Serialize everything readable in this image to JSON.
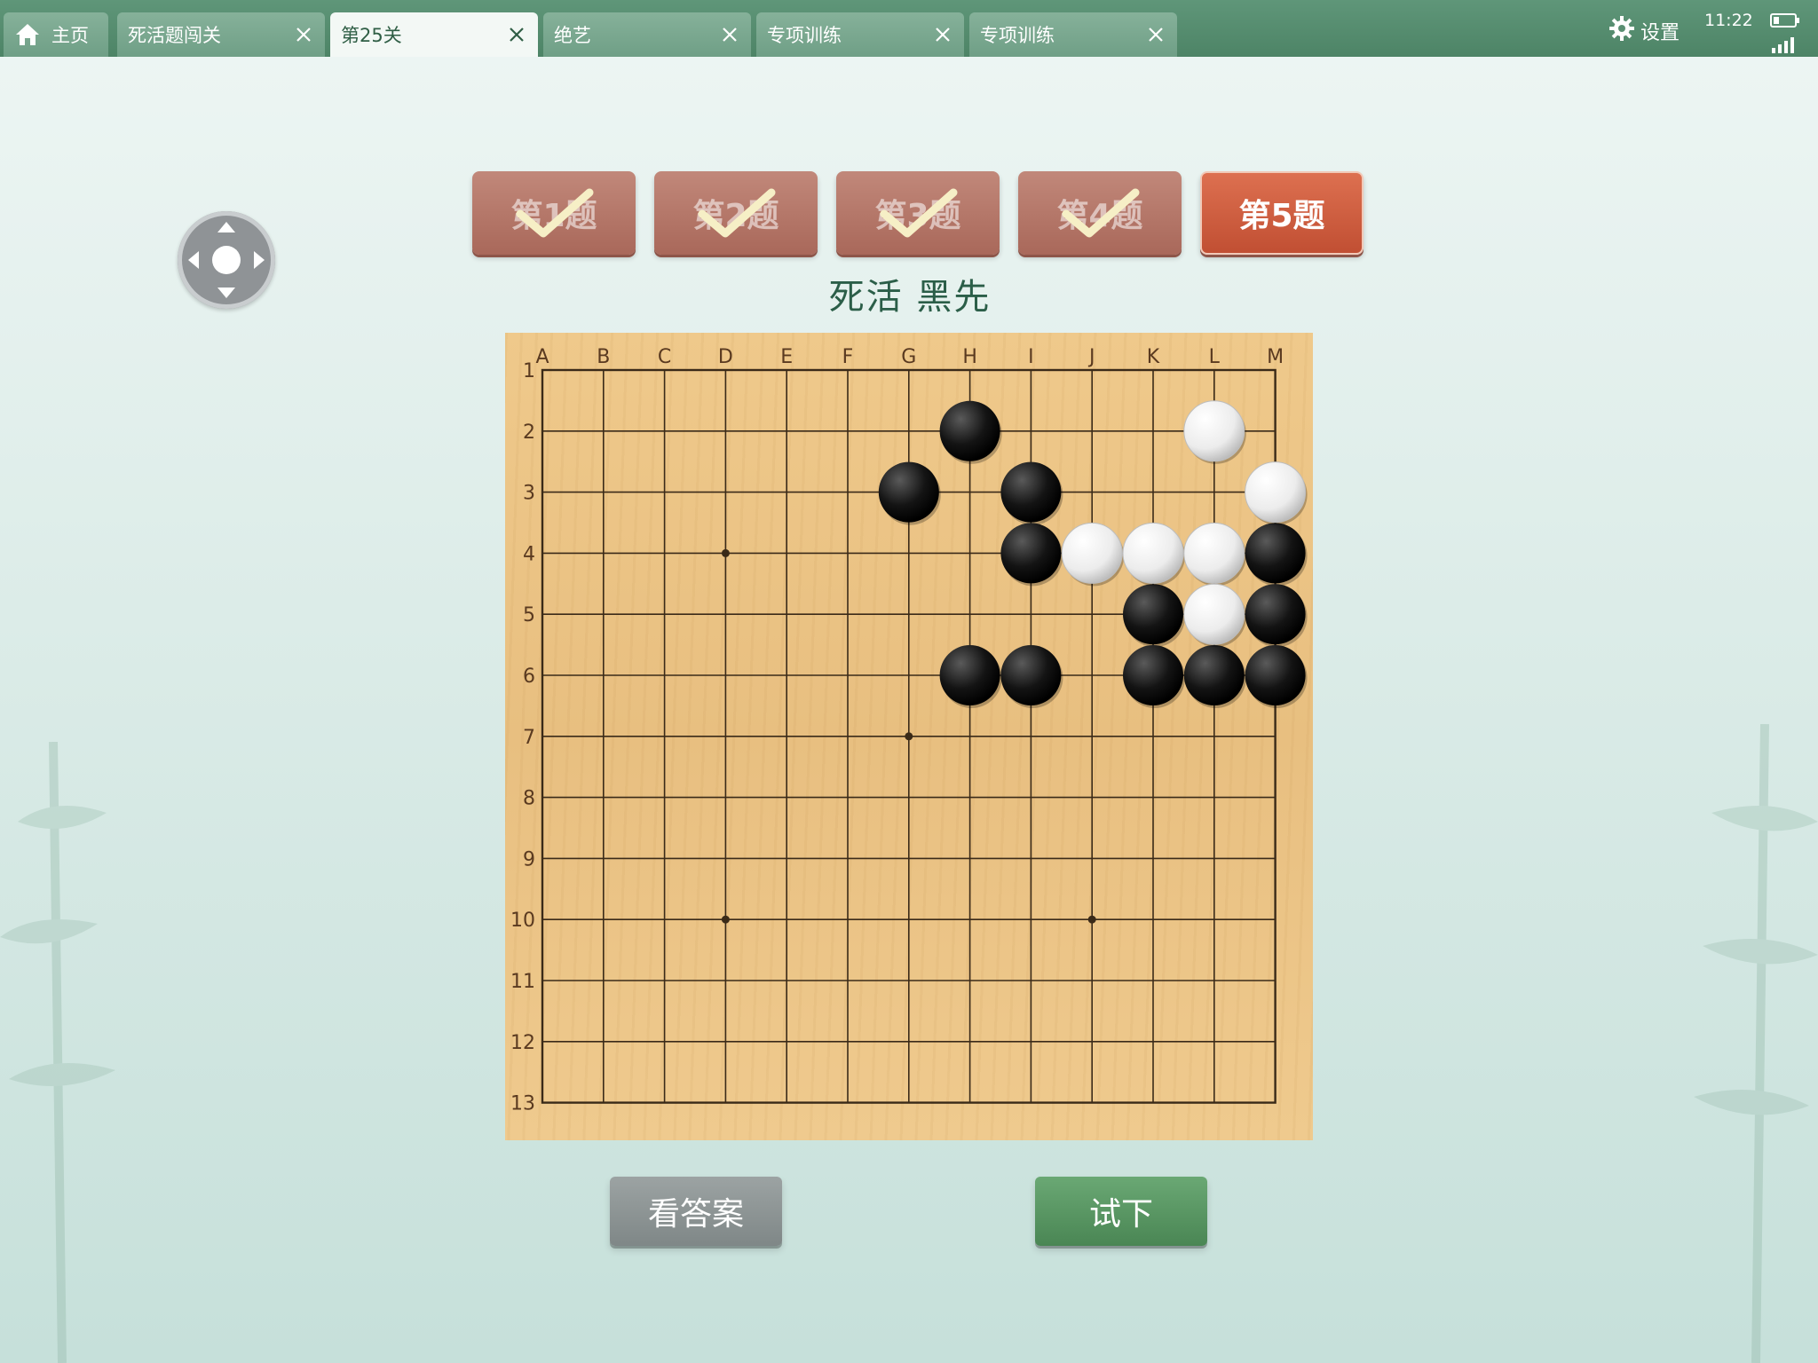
{
  "status_bar": {
    "settings_label": "设置",
    "time": "11:22"
  },
  "tabs": [
    {
      "label": "主页",
      "icon": "home-icon",
      "closable": false
    },
    {
      "label": "死活题闯关",
      "closable": true
    },
    {
      "label": "第25关",
      "closable": true,
      "active": true
    },
    {
      "label": "绝艺",
      "closable": true
    },
    {
      "label": "专项训练",
      "closable": true
    },
    {
      "label": "专项训练",
      "closable": true
    }
  ],
  "problems": [
    {
      "label": "第1题",
      "solved": true
    },
    {
      "label": "第2题",
      "solved": true
    },
    {
      "label": "第3题",
      "solved": true
    },
    {
      "label": "第4题",
      "solved": true
    },
    {
      "label": "第5题",
      "solved": false,
      "current": true
    }
  ],
  "prompt": "死活  黑先",
  "board": {
    "columns": [
      "A",
      "B",
      "C",
      "D",
      "E",
      "F",
      "G",
      "H",
      "I",
      "J",
      "K",
      "L",
      "M"
    ],
    "rows": [
      "1",
      "2",
      "3",
      "4",
      "5",
      "6",
      "7",
      "8",
      "9",
      "10",
      "11",
      "12",
      "13"
    ],
    "star_points": [
      "D4",
      "G7",
      "D10",
      "J10"
    ],
    "black_stones": [
      "H2",
      "G3",
      "I3",
      "I4",
      "M4",
      "K5",
      "M5",
      "H6",
      "I6",
      "K6",
      "L6",
      "M6"
    ],
    "white_stones": [
      "L2",
      "M3",
      "J4",
      "K4",
      "L4",
      "L5"
    ]
  },
  "buttons": {
    "answer_label": "看答案",
    "try_label": "试下"
  },
  "colors": {
    "accent_green": "#4d8466",
    "current_problem": "#c9553a",
    "board": "#edc688"
  }
}
